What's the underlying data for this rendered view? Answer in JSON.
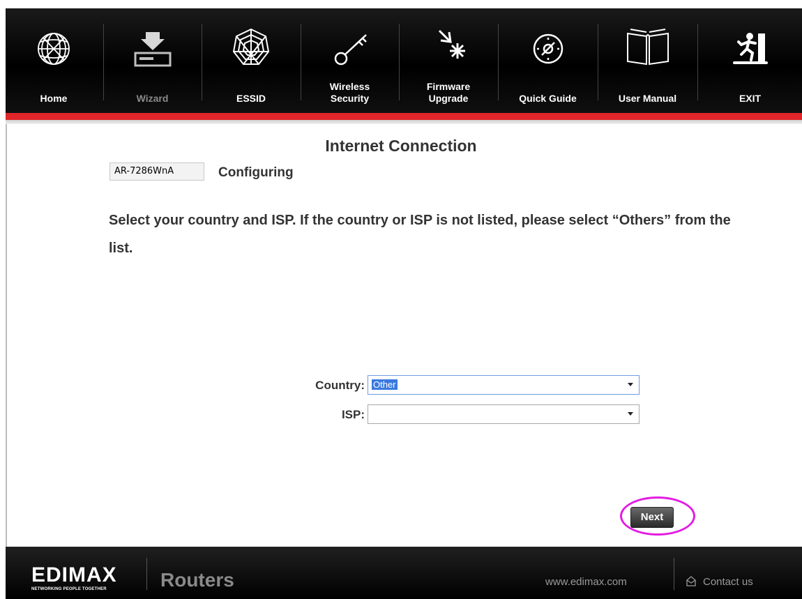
{
  "toolbar": {
    "items": [
      {
        "label": "Home",
        "icon": "globe-icon"
      },
      {
        "label": "Wizard",
        "icon": "wizard-icon",
        "disabled": true
      },
      {
        "label": "ESSID",
        "icon": "web-icon"
      },
      {
        "label": "Wireless Security",
        "icon": "key-icon"
      },
      {
        "label": "Firmware Upgrade",
        "icon": "firmware-icon"
      },
      {
        "label": "Quick Guide",
        "icon": "compass-icon"
      },
      {
        "label": "User Manual",
        "icon": "book-icon"
      },
      {
        "label": "EXIT",
        "icon": "exit-icon"
      }
    ]
  },
  "page": {
    "title": "Internet Connection",
    "model": "AR-7286WnA",
    "status": "Configuring",
    "instruction": "Select your country and ISP. If the country or ISP is not listed, please select “Others” from the list."
  },
  "form": {
    "country_label": "Country:",
    "country_value": "Other",
    "isp_label": "ISP:",
    "isp_value": ""
  },
  "actions": {
    "next_label": "Next"
  },
  "footer": {
    "brand": "EDIMAX",
    "tagline": "NETWORKING PEOPLE TOGETHER",
    "product": "Routers",
    "website": "www.edimax.com",
    "contact": "Contact us"
  },
  "colors": {
    "accent_red": "#e0262a",
    "highlight": "#e31de3",
    "selection": "#3a7ae0"
  }
}
